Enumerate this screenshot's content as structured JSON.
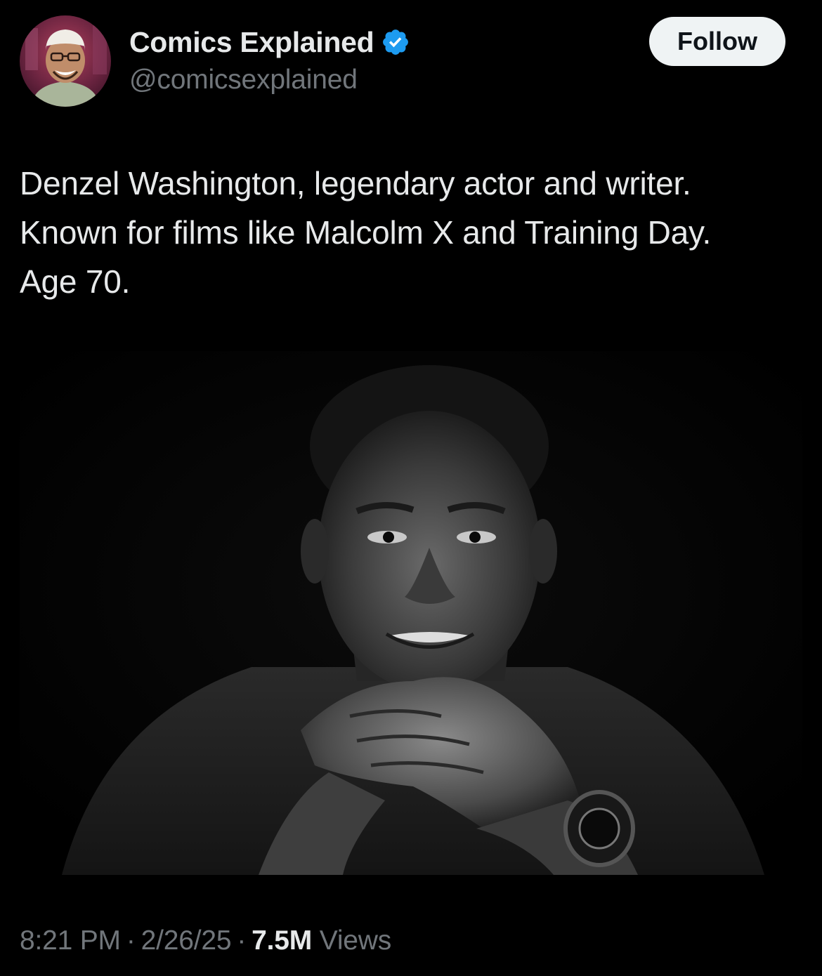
{
  "author": {
    "display_name": "Comics Explained",
    "handle": "@comicsexplained",
    "verified": true,
    "verified_icon": "verified-badge-icon",
    "verified_color": "#1d9bf0"
  },
  "follow_label": "Follow",
  "tweet": {
    "text": "Denzel Washington, legendary actor and writer.\nKnown for films like Malcolm X and Training Day.\nAge 70."
  },
  "meta": {
    "time": "8:21 PM",
    "separator": "·",
    "date": "2/26/25",
    "views_count": "7.5M",
    "views_label": "Views"
  },
  "colors": {
    "background": "#000000",
    "text_primary": "#e7e9ea",
    "text_secondary": "#71767b",
    "button_bg": "#eff3f4"
  }
}
